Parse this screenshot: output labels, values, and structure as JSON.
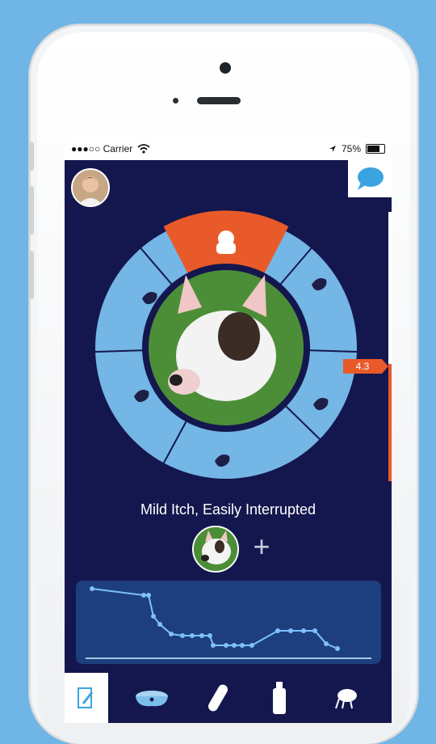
{
  "status_bar": {
    "carrier": "●●●○○ Carrier",
    "battery": "75%"
  },
  "severity": {
    "value": "4.3",
    "label": "Mild Itch, Easily Interrupted"
  },
  "colors": {
    "accent": "#e95a2a",
    "wheel": "#74b6e6",
    "background": "#14174d",
    "graph_bg": "#1d3f7d"
  },
  "icons": {
    "chat": "chat-bubble-icon",
    "add": "plus-icon",
    "tabs": [
      "journal-icon",
      "dog-bowl-icon",
      "pill-icon",
      "bottle-icon",
      "flea-icon"
    ]
  }
}
